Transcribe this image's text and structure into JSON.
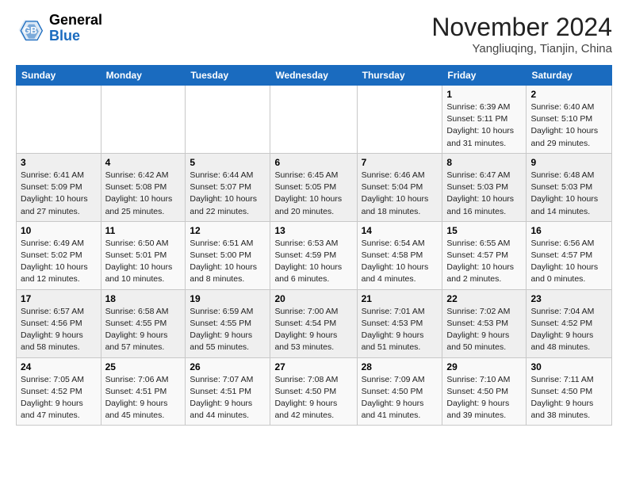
{
  "header": {
    "logo_line1": "General",
    "logo_line2": "Blue",
    "month": "November 2024",
    "location": "Yangliuqing, Tianjin, China"
  },
  "weekdays": [
    "Sunday",
    "Monday",
    "Tuesday",
    "Wednesday",
    "Thursday",
    "Friday",
    "Saturday"
  ],
  "weeks": [
    [
      {
        "day": "",
        "info": ""
      },
      {
        "day": "",
        "info": ""
      },
      {
        "day": "",
        "info": ""
      },
      {
        "day": "",
        "info": ""
      },
      {
        "day": "",
        "info": ""
      },
      {
        "day": "1",
        "info": "Sunrise: 6:39 AM\nSunset: 5:11 PM\nDaylight: 10 hours\nand 31 minutes."
      },
      {
        "day": "2",
        "info": "Sunrise: 6:40 AM\nSunset: 5:10 PM\nDaylight: 10 hours\nand 29 minutes."
      }
    ],
    [
      {
        "day": "3",
        "info": "Sunrise: 6:41 AM\nSunset: 5:09 PM\nDaylight: 10 hours\nand 27 minutes."
      },
      {
        "day": "4",
        "info": "Sunrise: 6:42 AM\nSunset: 5:08 PM\nDaylight: 10 hours\nand 25 minutes."
      },
      {
        "day": "5",
        "info": "Sunrise: 6:44 AM\nSunset: 5:07 PM\nDaylight: 10 hours\nand 22 minutes."
      },
      {
        "day": "6",
        "info": "Sunrise: 6:45 AM\nSunset: 5:05 PM\nDaylight: 10 hours\nand 20 minutes."
      },
      {
        "day": "7",
        "info": "Sunrise: 6:46 AM\nSunset: 5:04 PM\nDaylight: 10 hours\nand 18 minutes."
      },
      {
        "day": "8",
        "info": "Sunrise: 6:47 AM\nSunset: 5:03 PM\nDaylight: 10 hours\nand 16 minutes."
      },
      {
        "day": "9",
        "info": "Sunrise: 6:48 AM\nSunset: 5:03 PM\nDaylight: 10 hours\nand 14 minutes."
      }
    ],
    [
      {
        "day": "10",
        "info": "Sunrise: 6:49 AM\nSunset: 5:02 PM\nDaylight: 10 hours\nand 12 minutes."
      },
      {
        "day": "11",
        "info": "Sunrise: 6:50 AM\nSunset: 5:01 PM\nDaylight: 10 hours\nand 10 minutes."
      },
      {
        "day": "12",
        "info": "Sunrise: 6:51 AM\nSunset: 5:00 PM\nDaylight: 10 hours\nand 8 minutes."
      },
      {
        "day": "13",
        "info": "Sunrise: 6:53 AM\nSunset: 4:59 PM\nDaylight: 10 hours\nand 6 minutes."
      },
      {
        "day": "14",
        "info": "Sunrise: 6:54 AM\nSunset: 4:58 PM\nDaylight: 10 hours\nand 4 minutes."
      },
      {
        "day": "15",
        "info": "Sunrise: 6:55 AM\nSunset: 4:57 PM\nDaylight: 10 hours\nand 2 minutes."
      },
      {
        "day": "16",
        "info": "Sunrise: 6:56 AM\nSunset: 4:57 PM\nDaylight: 10 hours\nand 0 minutes."
      }
    ],
    [
      {
        "day": "17",
        "info": "Sunrise: 6:57 AM\nSunset: 4:56 PM\nDaylight: 9 hours\nand 58 minutes."
      },
      {
        "day": "18",
        "info": "Sunrise: 6:58 AM\nSunset: 4:55 PM\nDaylight: 9 hours\nand 57 minutes."
      },
      {
        "day": "19",
        "info": "Sunrise: 6:59 AM\nSunset: 4:55 PM\nDaylight: 9 hours\nand 55 minutes."
      },
      {
        "day": "20",
        "info": "Sunrise: 7:00 AM\nSunset: 4:54 PM\nDaylight: 9 hours\nand 53 minutes."
      },
      {
        "day": "21",
        "info": "Sunrise: 7:01 AM\nSunset: 4:53 PM\nDaylight: 9 hours\nand 51 minutes."
      },
      {
        "day": "22",
        "info": "Sunrise: 7:02 AM\nSunset: 4:53 PM\nDaylight: 9 hours\nand 50 minutes."
      },
      {
        "day": "23",
        "info": "Sunrise: 7:04 AM\nSunset: 4:52 PM\nDaylight: 9 hours\nand 48 minutes."
      }
    ],
    [
      {
        "day": "24",
        "info": "Sunrise: 7:05 AM\nSunset: 4:52 PM\nDaylight: 9 hours\nand 47 minutes."
      },
      {
        "day": "25",
        "info": "Sunrise: 7:06 AM\nSunset: 4:51 PM\nDaylight: 9 hours\nand 45 minutes."
      },
      {
        "day": "26",
        "info": "Sunrise: 7:07 AM\nSunset: 4:51 PM\nDaylight: 9 hours\nand 44 minutes."
      },
      {
        "day": "27",
        "info": "Sunrise: 7:08 AM\nSunset: 4:50 PM\nDaylight: 9 hours\nand 42 minutes."
      },
      {
        "day": "28",
        "info": "Sunrise: 7:09 AM\nSunset: 4:50 PM\nDaylight: 9 hours\nand 41 minutes."
      },
      {
        "day": "29",
        "info": "Sunrise: 7:10 AM\nSunset: 4:50 PM\nDaylight: 9 hours\nand 39 minutes."
      },
      {
        "day": "30",
        "info": "Sunrise: 7:11 AM\nSunset: 4:50 PM\nDaylight: 9 hours\nand 38 minutes."
      }
    ]
  ]
}
